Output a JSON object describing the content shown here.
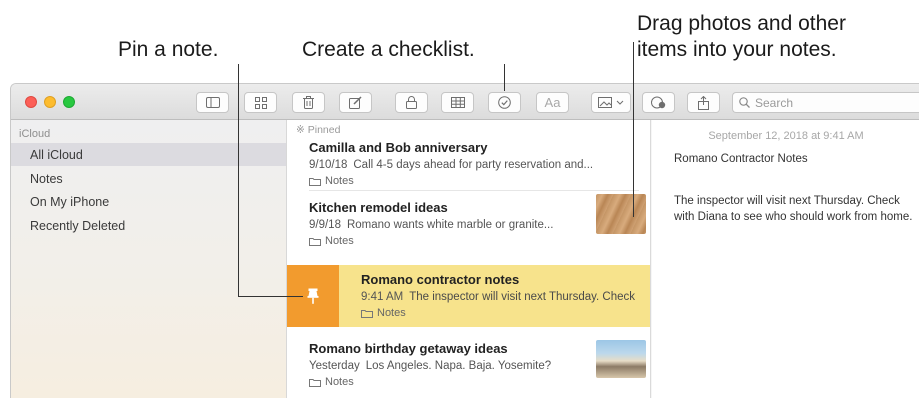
{
  "callouts": {
    "pin": "Pin a note.",
    "checklist": "Create a checklist.",
    "drag_line1": "Drag photos and other",
    "drag_line2": "items into your notes."
  },
  "toolbar": {
    "font_button_label": "Aa",
    "search_placeholder": "Search",
    "buttons": [
      "sidebar-toggle-icon",
      "gallery-icon",
      "trash-icon",
      "compose-icon",
      "lock-icon",
      "table-icon",
      "checklist-icon",
      "format-icon",
      "media-icon",
      "collaborate-icon",
      "share-icon"
    ]
  },
  "sidebar": {
    "account": "iCloud",
    "items": [
      {
        "label": "All iCloud",
        "selected": true
      },
      {
        "label": "Notes",
        "selected": false
      },
      {
        "label": "On My iPhone",
        "selected": false
      },
      {
        "label": "Recently Deleted",
        "selected": false
      }
    ]
  },
  "notes_list": {
    "pinned_label": "Pinned",
    "notes": [
      {
        "title": "Camilla and Bob anniversary",
        "date": "9/10/18",
        "snippet": "Call 4-5 days ahead for party reservation and...",
        "folder": "Notes"
      },
      {
        "title": "Kitchen remodel ideas",
        "date": "9/9/18",
        "snippet": "Romano wants white marble or granite...",
        "folder": "Notes"
      },
      {
        "title": "Romano contractor notes",
        "date": "9:41 AM",
        "snippet": "The inspector will visit next Thursday. Check",
        "folder": "Notes",
        "highlighted": true
      },
      {
        "title": "Romano birthday getaway ideas",
        "date": "Yesterday",
        "snippet": "Los Angeles. Napa. Baja. Yosemite?",
        "folder": "Notes"
      }
    ]
  },
  "detail": {
    "date": "September 12, 2018 at 9:41 AM",
    "title": "Romano Contractor Notes",
    "body": "The inspector will visit next Thursday. Check with Diana to see who should work from home."
  },
  "colors": {
    "traffic_red": "#fc5f57",
    "traffic_yellow": "#fdbc2e",
    "traffic_green": "#28c840",
    "pin_orange": "#f29b2e",
    "highlight_yellow": "#f7e38c"
  }
}
